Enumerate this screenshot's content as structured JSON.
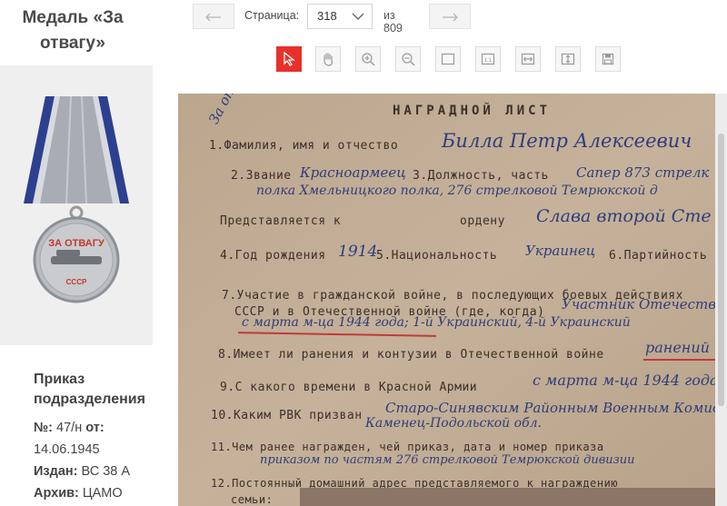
{
  "sidebar": {
    "title": "Медаль «За отвагу»",
    "medal_image": {
      "icon": "medal-za-otvagu",
      "text": "ЗА ОТВАГУ",
      "mark": "СССР"
    },
    "order": {
      "title": "Приказ подразделения",
      "number_label": "№:",
      "number_value": "47/н",
      "from_label": "от:",
      "date": "14.06.1945",
      "issued_label": "Издан:",
      "issued_value": "ВС 38 А",
      "archive_label": "Архив:",
      "archive_value": "ЦАМО"
    }
  },
  "toolbar": {
    "prev_icon": "arrow-left-icon",
    "page_label": "Страница:",
    "current_page": "318",
    "total_label": "из 809",
    "next_icon": "arrow-right-icon",
    "tools": [
      "pointer-icon",
      "hand-icon",
      "zoom-in-icon",
      "zoom-out-icon",
      "rectangle-icon",
      "actual-size-icon",
      "fit-width-icon",
      "fit-height-icon",
      "save-icon"
    ],
    "accent": "#e8312a"
  },
  "document": {
    "heading": "НАГРАДНОЙ ЛИСТ",
    "corner_note": "За отв",
    "lines": [
      {
        "printed": "1.Фамилия, имя и отчество",
        "hand": "Билла Петр Алексеевич"
      },
      {
        "printed": "2.Звание",
        "hand": "Красноармеец",
        "printed2": "3.Должность, часть",
        "hand2": "Сапер 873 стрелк"
      },
      {
        "hand": "полка Хмельницкого полка, 276 стрелковой Темрюкской д"
      },
      {
        "printed": "Представляется к",
        "printed2": "ордену",
        "hand": "Слава второй Сте"
      },
      {
        "printed": "4.Год рождения",
        "hand": "1914",
        "printed2": "5.Национальность",
        "hand2": "Украинец",
        "printed3": "6.Партийность"
      },
      {
        "printed": "7.Участие в гражданской войне, в последующих боевых действиях"
      },
      {
        "printed": "СССР и в Отечественной войне (где, когда)",
        "hand": "Участник Отечеств"
      },
      {
        "hand": "с марта м-ца 1944 года; 1-й Украинский, 4-й Украинский"
      },
      {
        "printed": "8.Имеет ли ранения и контузии в Отечественной войне",
        "hand": "ранений"
      },
      {
        "printed": "9.С какого времени в Красной Армии",
        "hand": "с марта м-ца 1944 года"
      },
      {
        "printed": "10.Каким РВК призван",
        "hand": "Старо-Синявским Районным Военным Комисс"
      },
      {
        "hand": "Каменец-Подольской обл."
      },
      {
        "printed": "11.Чем ранее награжден, чей приказ, дата и номер приказа",
        "hand": "приказом по частям 276 стрелковой Темрюкской дивизии"
      },
      {
        "printed": "12.Постоянный домашний адрес представляемого к награждению"
      },
      {
        "printed": "семьи:"
      }
    ]
  }
}
